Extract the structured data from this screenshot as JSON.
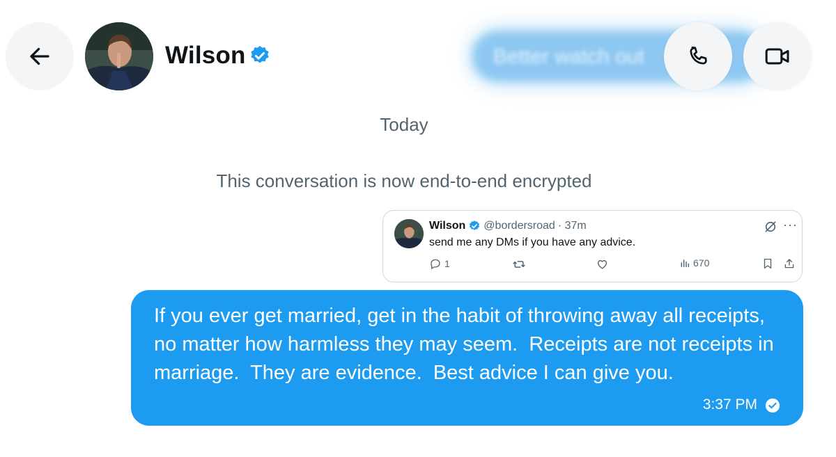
{
  "header": {
    "contact_name": "Wilson",
    "blurred_preview": "Better watch out",
    "back_icon": "arrow-left-icon",
    "call_icon": "phone-icon",
    "video_icon": "video-camera-icon"
  },
  "conversation": {
    "date_separator": "Today",
    "encryption_note": "This conversation is now end-to-end encrypted"
  },
  "quoted_tweet": {
    "author_name": "Wilson",
    "handle": "@bordersroad",
    "time": "· 37m",
    "text": "send me any DMs if you have any advice.",
    "replies": "1",
    "views": "670"
  },
  "message": {
    "text": "If you ever get married, get in the habit of throwing away all receipts, no matter how harmless they may seem.  Receipts are not receipts in marriage.  They are evidence.  Best advice I can give you.",
    "time": "3:37 PM"
  },
  "colors": {
    "accent": "#1d9bf0",
    "secondary_text": "#536471",
    "button_bg": "#f4f5f6"
  }
}
